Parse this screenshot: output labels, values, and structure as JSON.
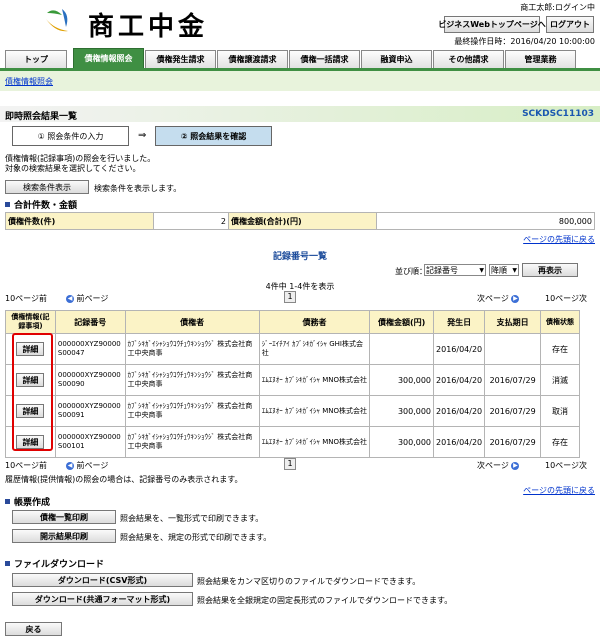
{
  "header": {
    "logo_text": "商工中金",
    "user": "商工太郎:ログイン中",
    "top_btn": "ビジネスWebトップページへ",
    "logout_btn": "ログアウト",
    "last_op": "最終操作日時：2016/04/20 10:00:00"
  },
  "tabs": [
    "トップ",
    "債権情報照会",
    "債権発生請求",
    "債権譲渡請求",
    "債権一括請求",
    "融資申込",
    "その他請求",
    "管理業務"
  ],
  "subnav": "債権情報照会",
  "page": {
    "title": "即時照会結果一覧",
    "code": "SCKDSC11103",
    "step1": "① 照会条件の入力",
    "arrow": "⇒",
    "step2": "② 照会結果を確認",
    "desc1": "債権情報(記録事項)の照会を行いました。",
    "desc2": "対象の検索結果を選択してください。"
  },
  "search": {
    "button": "検索条件表示",
    "text": "検索条件を表示します。"
  },
  "totals": {
    "heading": "合計件数・金額",
    "count_label": "債権件数(件)",
    "count_value": "2",
    "amount_label": "債権金額(合計)(円)",
    "amount_value": "800,000",
    "page_top": "ページの先頭に戻る"
  },
  "list": {
    "heading": "記録番号一覧",
    "sort_label": "並び順：",
    "sort_field": "記録番号",
    "sort_dir": "降順",
    "display_btn": "再表示",
    "count_text": "4件中 1-4件を表示",
    "prev10": "10ページ前",
    "prev": "前ページ",
    "page": "1",
    "next": "次ページ",
    "next10": "10ページ次"
  },
  "table": {
    "headers": [
      "債権情報(記録事項)",
      "記録番号",
      "債権者",
      "債務者",
      "債権金額(円)",
      "発生日",
      "支払期日",
      "債権状態"
    ],
    "detail_label": "詳細",
    "rows": [
      {
        "record": "000000XYZ90000S00047",
        "creditor": "ｶﾌﾞｼｷｶﾞｲｼｬｼｮｳｺｳﾁｭｳｷﾝｼｮｳｼﾞ 株式会社商工中央商事",
        "debtor": "ｼﾞｰｴｲﾁｱｲ ｶﾌﾞｼｷｶﾞｲｼｬ GHI株式会社",
        "amount": "",
        "issue": "2016/04/20",
        "due": "",
        "status": "存在"
      },
      {
        "record": "000000XYZ90000S00090",
        "creditor": "ｶﾌﾞｼｷｶﾞｲｼｬｼｮｳｺｳﾁｭｳｷﾝｼｮｳｼﾞ 株式会社商工中央商事",
        "debtor": "ｴﾑｴﾇｵｰ ｶﾌﾞｼｷｶﾞｲｼｬ MNO株式会社",
        "amount": "300,000",
        "issue": "2016/04/20",
        "due": "2016/07/29",
        "status": "消滅"
      },
      {
        "record": "000000XYZ90000S00091",
        "creditor": "ｶﾌﾞｼｷｶﾞｲｼｬｼｮｳｺｳﾁｭｳｷﾝｼｮｳｼﾞ 株式会社商工中央商事",
        "debtor": "ｴﾑｴﾇｵｰ ｶﾌﾞｼｷｶﾞｲｼｬ MNO株式会社",
        "amount": "300,000",
        "issue": "2016/04/20",
        "due": "2016/07/29",
        "status": "取消"
      },
      {
        "record": "000000XYZ90000S00101",
        "creditor": "ｶﾌﾞｼｷｶﾞｲｼｬｼｮｳｺｳﾁｭｳｷﾝｼｮｳｼﾞ 株式会社商工中央商事",
        "debtor": "ｴﾑｴﾇｵｰ ｶﾌﾞｼｷｶﾞｲｼｬ MNO株式会社",
        "amount": "300,000",
        "issue": "2016/04/20",
        "due": "2016/07/29",
        "status": "存在"
      }
    ]
  },
  "note": "履歴情報(提供情報)の照会の場合は、記録番号のみ表示されます。",
  "report": {
    "heading": "帳票作成",
    "btn1": "債権一覧印刷",
    "text1": "照会結果を、一覧形式で印刷できます。",
    "btn2": "開示結果印刷",
    "text2": "照会結果を、規定の形式で印刷できます。"
  },
  "download": {
    "heading": "ファイルダウンロード",
    "btn1": "ダウンロード(CSV形式)",
    "text1": "照会結果をカンマ区切りのファイルでダウンロードできます。",
    "btn2": "ダウンロード(共通フォーマット形式)",
    "text2": "照会結果を全銀規定の固定長形式のファイルでダウンロードできます。"
  },
  "back": "戻る"
}
